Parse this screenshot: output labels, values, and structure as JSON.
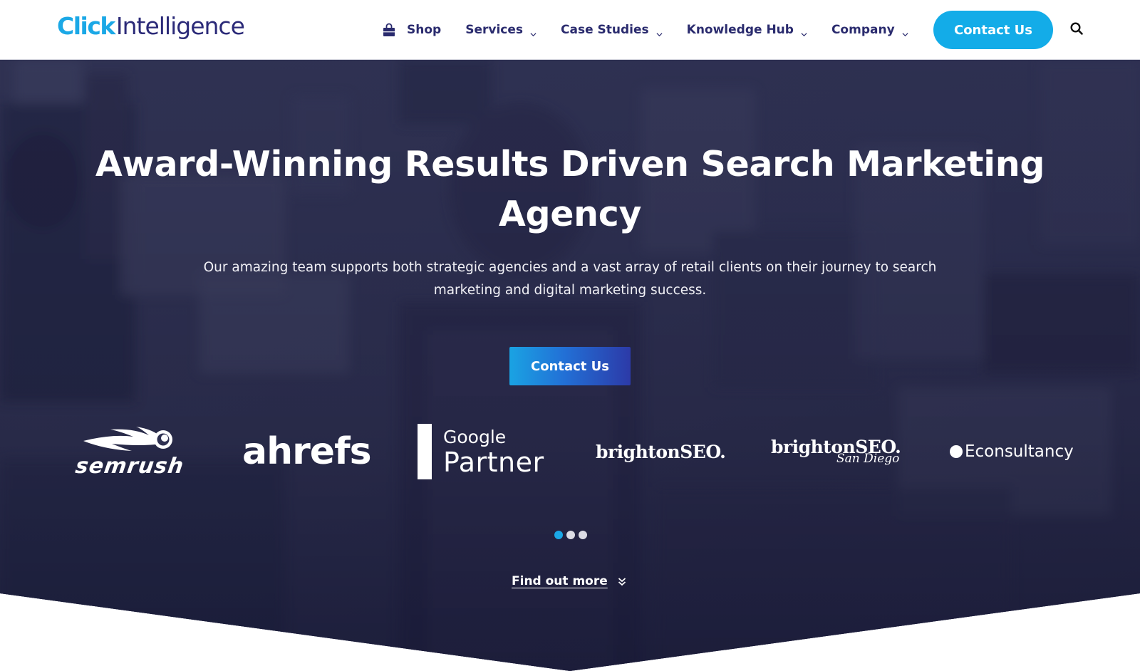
{
  "header": {
    "logo": {
      "part1": "Click",
      "part2": "Intelligence"
    },
    "nav": [
      {
        "label": "Shop",
        "icon": "shopping-bag-icon",
        "has_dropdown": false
      },
      {
        "label": "Services",
        "has_dropdown": true
      },
      {
        "label": "Case Studies",
        "has_dropdown": true
      },
      {
        "label": "Knowledge Hub",
        "has_dropdown": true
      },
      {
        "label": "Company",
        "has_dropdown": true
      }
    ],
    "contact_button": "Contact Us",
    "search_icon": "search-icon"
  },
  "hero": {
    "title": "Award-Winning Results Driven Search Marketing Agency",
    "subtitle": "Our amazing team supports both strategic agencies and a vast array of retail clients on their journey to search marketing and digital marketing success.",
    "cta": "Contact Us",
    "partners": {
      "semrush": "semrush",
      "ahrefs": "ahrefs",
      "google_line1": "Google",
      "google_line2": "Partner",
      "brighton": "brightonSEO.",
      "brighton_sd_main": "brightonSEO.",
      "brighton_sd_sub": "San Diego",
      "econsultancy": "Econsultancy"
    },
    "carousel": {
      "total": 3,
      "active_index": 0
    },
    "find_more": "Find out more"
  },
  "colors": {
    "brand_blue": "#1ba8e6",
    "brand_navy": "#2a2b6e",
    "hero_dark": "#2d2f4d"
  }
}
